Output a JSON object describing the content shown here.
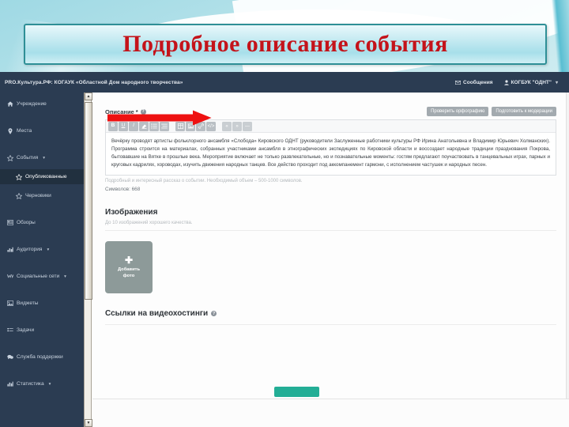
{
  "slide": {
    "title": "Подробное описание события",
    "title_color": "#c4131a",
    "banner_border_color": "#2e8f96"
  },
  "app": {
    "topbar": {
      "brand": "PRO.Культура.РФ: КОГАУК «Областной Дом народного творчества»",
      "messages_label": "Сообщения",
      "messages_icon": "envelope-icon",
      "account_label": "КОГБУК \"ОДНТ\"",
      "account_icon": "user-icon",
      "account_caret": "▾",
      "background": "#2b3c52"
    },
    "sidebar": {
      "background": "#2b3c52",
      "active_background": "#21303f",
      "items": [
        {
          "label": "Учреждение",
          "icon": "home-icon",
          "sub": false,
          "active": false,
          "caret": ""
        },
        {
          "label": "Места",
          "icon": "pin-icon",
          "sub": false,
          "active": false,
          "caret": ""
        },
        {
          "label": "События",
          "icon": "star-icon",
          "sub": false,
          "active": false,
          "caret": "▾"
        },
        {
          "label": "Опубликованные",
          "icon": "star-icon",
          "sub": true,
          "active": true,
          "caret": ""
        },
        {
          "label": "Черновики",
          "icon": "star-icon",
          "sub": true,
          "active": false,
          "caret": ""
        },
        {
          "label": "Обзоры",
          "icon": "news-icon",
          "sub": false,
          "active": false,
          "caret": ""
        },
        {
          "label": "Аудитория",
          "icon": "chart-icon",
          "sub": false,
          "active": false,
          "caret": "▾"
        },
        {
          "label": "Социальные сети",
          "icon": "share-icon",
          "sub": false,
          "active": false,
          "caret": "▾"
        },
        {
          "label": "Виджеты",
          "icon": "widget-icon",
          "sub": false,
          "active": false,
          "caret": ""
        },
        {
          "label": "Задачи",
          "icon": "tasks-icon",
          "sub": false,
          "active": false,
          "caret": ""
        },
        {
          "label": "Служба поддержки",
          "icon": "support-icon",
          "sub": false,
          "active": false,
          "caret": ""
        },
        {
          "label": "Статистика",
          "icon": "bars-icon",
          "sub": false,
          "active": false,
          "caret": "▾"
        }
      ]
    },
    "scrollbar": {
      "up_arrow": "▲",
      "down_arrow": "▼"
    },
    "form": {
      "description_label": "Описание",
      "description_required_mark": "*",
      "description_help_icon": "question-icon",
      "spellcheck_button": "Проверить орфографию",
      "moderation_button": "Подготовить к модерации",
      "toolbar_buttons": [
        {
          "name": "bold-icon",
          "glyph": "B"
        },
        {
          "name": "underline-icon",
          "glyph": "U"
        },
        {
          "name": "italic-icon",
          "glyph": "I"
        },
        {
          "name": "eraser-icon",
          "glyph": "✎"
        },
        {
          "name": "bullet-list-icon",
          "glyph": "☰"
        },
        {
          "name": "number-list-icon",
          "glyph": "☰"
        },
        {
          "name": "table-icon",
          "glyph": "▥"
        },
        {
          "name": "image-icon",
          "glyph": "▤"
        },
        {
          "name": "link-icon",
          "glyph": "🔗"
        },
        {
          "name": "source-code-icon",
          "glyph": "‹›"
        },
        {
          "name": "quote-left-icon",
          "glyph": "«"
        },
        {
          "name": "quote-right-icon",
          "glyph": "»"
        },
        {
          "name": "dash-icon",
          "glyph": "—"
        }
      ],
      "description_text": "Вечёрку проводят артисты фольклорного ансамбля «Слобода» Кировского ОДНТ (руководители Заслуженные работники культуры РФ Ирина Анатольевна и Владимир Юрьевич Холманских). Программа строится на материалах, собранных участниками ансамбля в этнографических экспедициях по Кировской области и воссоздает народные традиции празднования Покрова, бытовавшие на Вятке в прошлые века. Мероприятие включает не только развлекательные, но и познавательные моменты: гостям предлагают поучаствовать в танцевальных играх, парных и круговых кадрилях, хороводах, изучить движения народных танцев. Все действо проходит под аккомпанемент гармони, с исполнением частушек и народных песен.",
      "description_helper": "Подробный и интересный рассказ о событии. Необходимый объем – 500-1000 символов.",
      "char_counter": "Символов: 668",
      "images_title": "Изображения",
      "images_sub": "До 10 изображений хорошего качества.",
      "add_photo_plus": "✚",
      "add_photo_label_line1": "Добавить",
      "add_photo_label_line2": "фото",
      "video_title": "Ссылки на видеохостинги",
      "video_help_icon": "question-icon",
      "submit_button_color": "#23ae96"
    }
  },
  "annotation": {
    "arrow_name": "red-pointer-arrow",
    "arrow_color": "#ee1111"
  }
}
